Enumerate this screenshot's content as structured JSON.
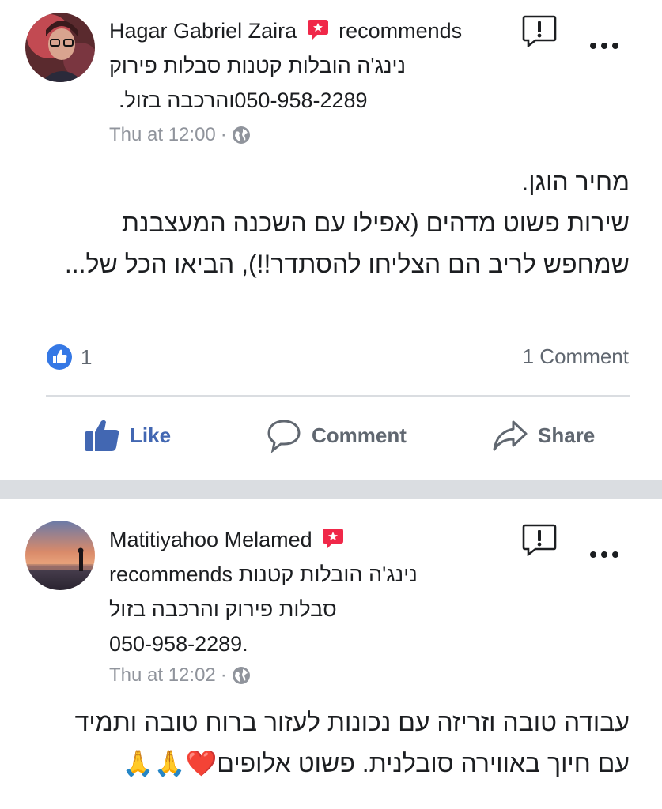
{
  "posts": [
    {
      "author": "Hagar Gabriel Zaira",
      "recommends": "recommends",
      "page_line1": "נינג'ה הובלות קטנות סבלות פירוק",
      "page_line2": "050-958-2289והרכבה בזול.",
      "time": "Thu at 12:00",
      "separator": "·",
      "body": "מחיר הוגן.\nשירות פשוט מדהים (אפילו עם השכנה המעצבנת\nשמחפש לריב הם הצליחו להסתדר!!), הביאו הכל של...",
      "reaction_count": "1",
      "comment_count": "1 Comment",
      "actions": {
        "like": "Like",
        "comment": "Comment",
        "share": "Share"
      }
    },
    {
      "author": "Matitiyahoo Melamed",
      "recommends_line": "נינג'ה הובלות קטנות recommends",
      "page_line2": "סבלות פירוק והרכבה בזול",
      "page_line3": "050-958-2289.",
      "time": "Thu at 12:02",
      "separator": "·",
      "body": "עבודה טובה וזריזה עם נכונות לעזור ברוח טובה ותמיד\nעם חיוך באווירה סובלנית. פשוט אלופים❤️🙏🙏"
    }
  ],
  "icons": {
    "recommend_badge": "recommend-badge-icon",
    "report": "report-icon",
    "more": "more-options-icon",
    "globe": "globe-icon",
    "like": "like-icon",
    "comment": "comment-icon",
    "share": "share-icon"
  },
  "colors": {
    "brand_blue": "#4267b2",
    "badge_red": "#f02849",
    "meta_gray": "#90949c",
    "action_gray": "#606770",
    "divider": "#dadde1"
  }
}
